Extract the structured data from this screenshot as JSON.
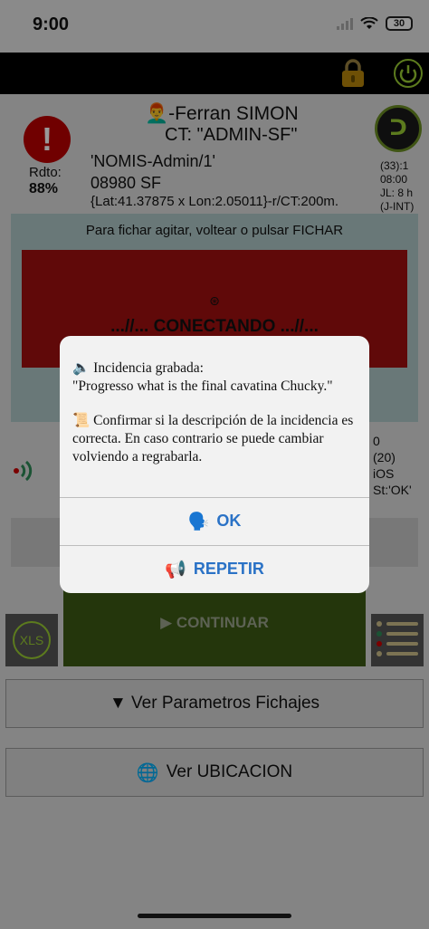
{
  "status_bar": {
    "time": "9:00",
    "battery": "30"
  },
  "header": {
    "user": "👨‍🦰-Ferran SIMON",
    "ct": "CT: \"ADMIN-SF\"",
    "user_id": "'NOMIS-Admin/1'",
    "zip": "08980 SF",
    "coords": "{Lat:41.37875 x Lon:2.05011}-r/CT:200m.",
    "rdto_label": "Rdto:",
    "rdto_value": "88%",
    "logo_text": "ᑐ",
    "right_info": [
      "(33):1",
      "08:00",
      "JL: 8 h",
      "(J-INT)"
    ]
  },
  "fichar": {
    "instruction": "Para fichar agitar, voltear o pulsar FICHAR",
    "status": "...//... CONECTANDO ...//..."
  },
  "side_stats": [
    "0",
    "(20)",
    "iOS",
    "St:'OK'"
  ],
  "buttons": {
    "xls": "XLS",
    "continuar": "▶ CONTINUAR",
    "ver_parametros": "▼ Ver Parametros Fichajes",
    "ver_ubicacion": "Ver UBICACION"
  },
  "dialog": {
    "line1": "🔈 Incidencia grabada:",
    "line2": "\"Progresso what is the final cavatina Chucky.\"",
    "line3": "📜 Confirmar si la descripción de la incidencia es correcta. En caso contrario se puede cambiar volviendo a regrabarla.",
    "ok_icon": "🗣️",
    "ok_label": "OK",
    "repetir_icon": "📢",
    "repetir_label": "REPETIR"
  }
}
